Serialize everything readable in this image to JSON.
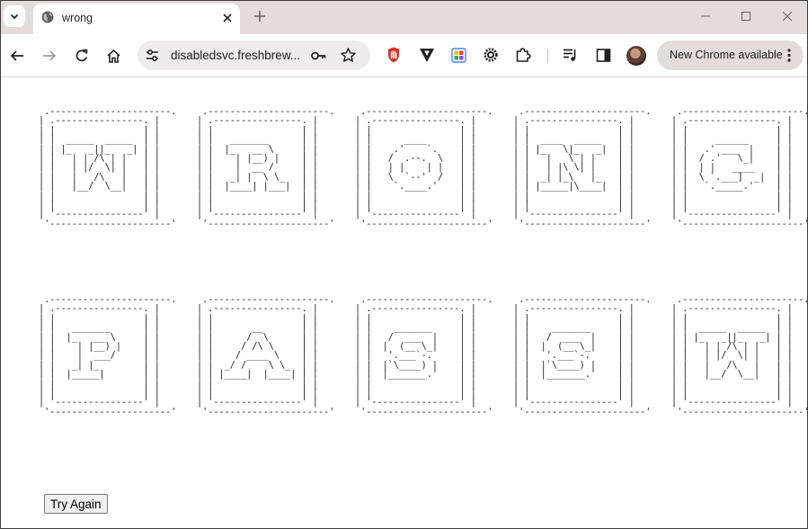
{
  "browser": {
    "tab": {
      "title": "wrong"
    },
    "address_bar": {
      "url": "disabledsvc.freshbrew..."
    },
    "update_chip": {
      "label": "New Chrome available"
    }
  },
  "page": {
    "art_rows": [
      {
        "letters": [
          "W",
          "R",
          "O",
          "N",
          "G"
        ]
      },
      {
        "letters": [
          "P",
          "A",
          "S",
          "S",
          "W"
        ]
      }
    ],
    "try_again_label": "Try Again"
  }
}
